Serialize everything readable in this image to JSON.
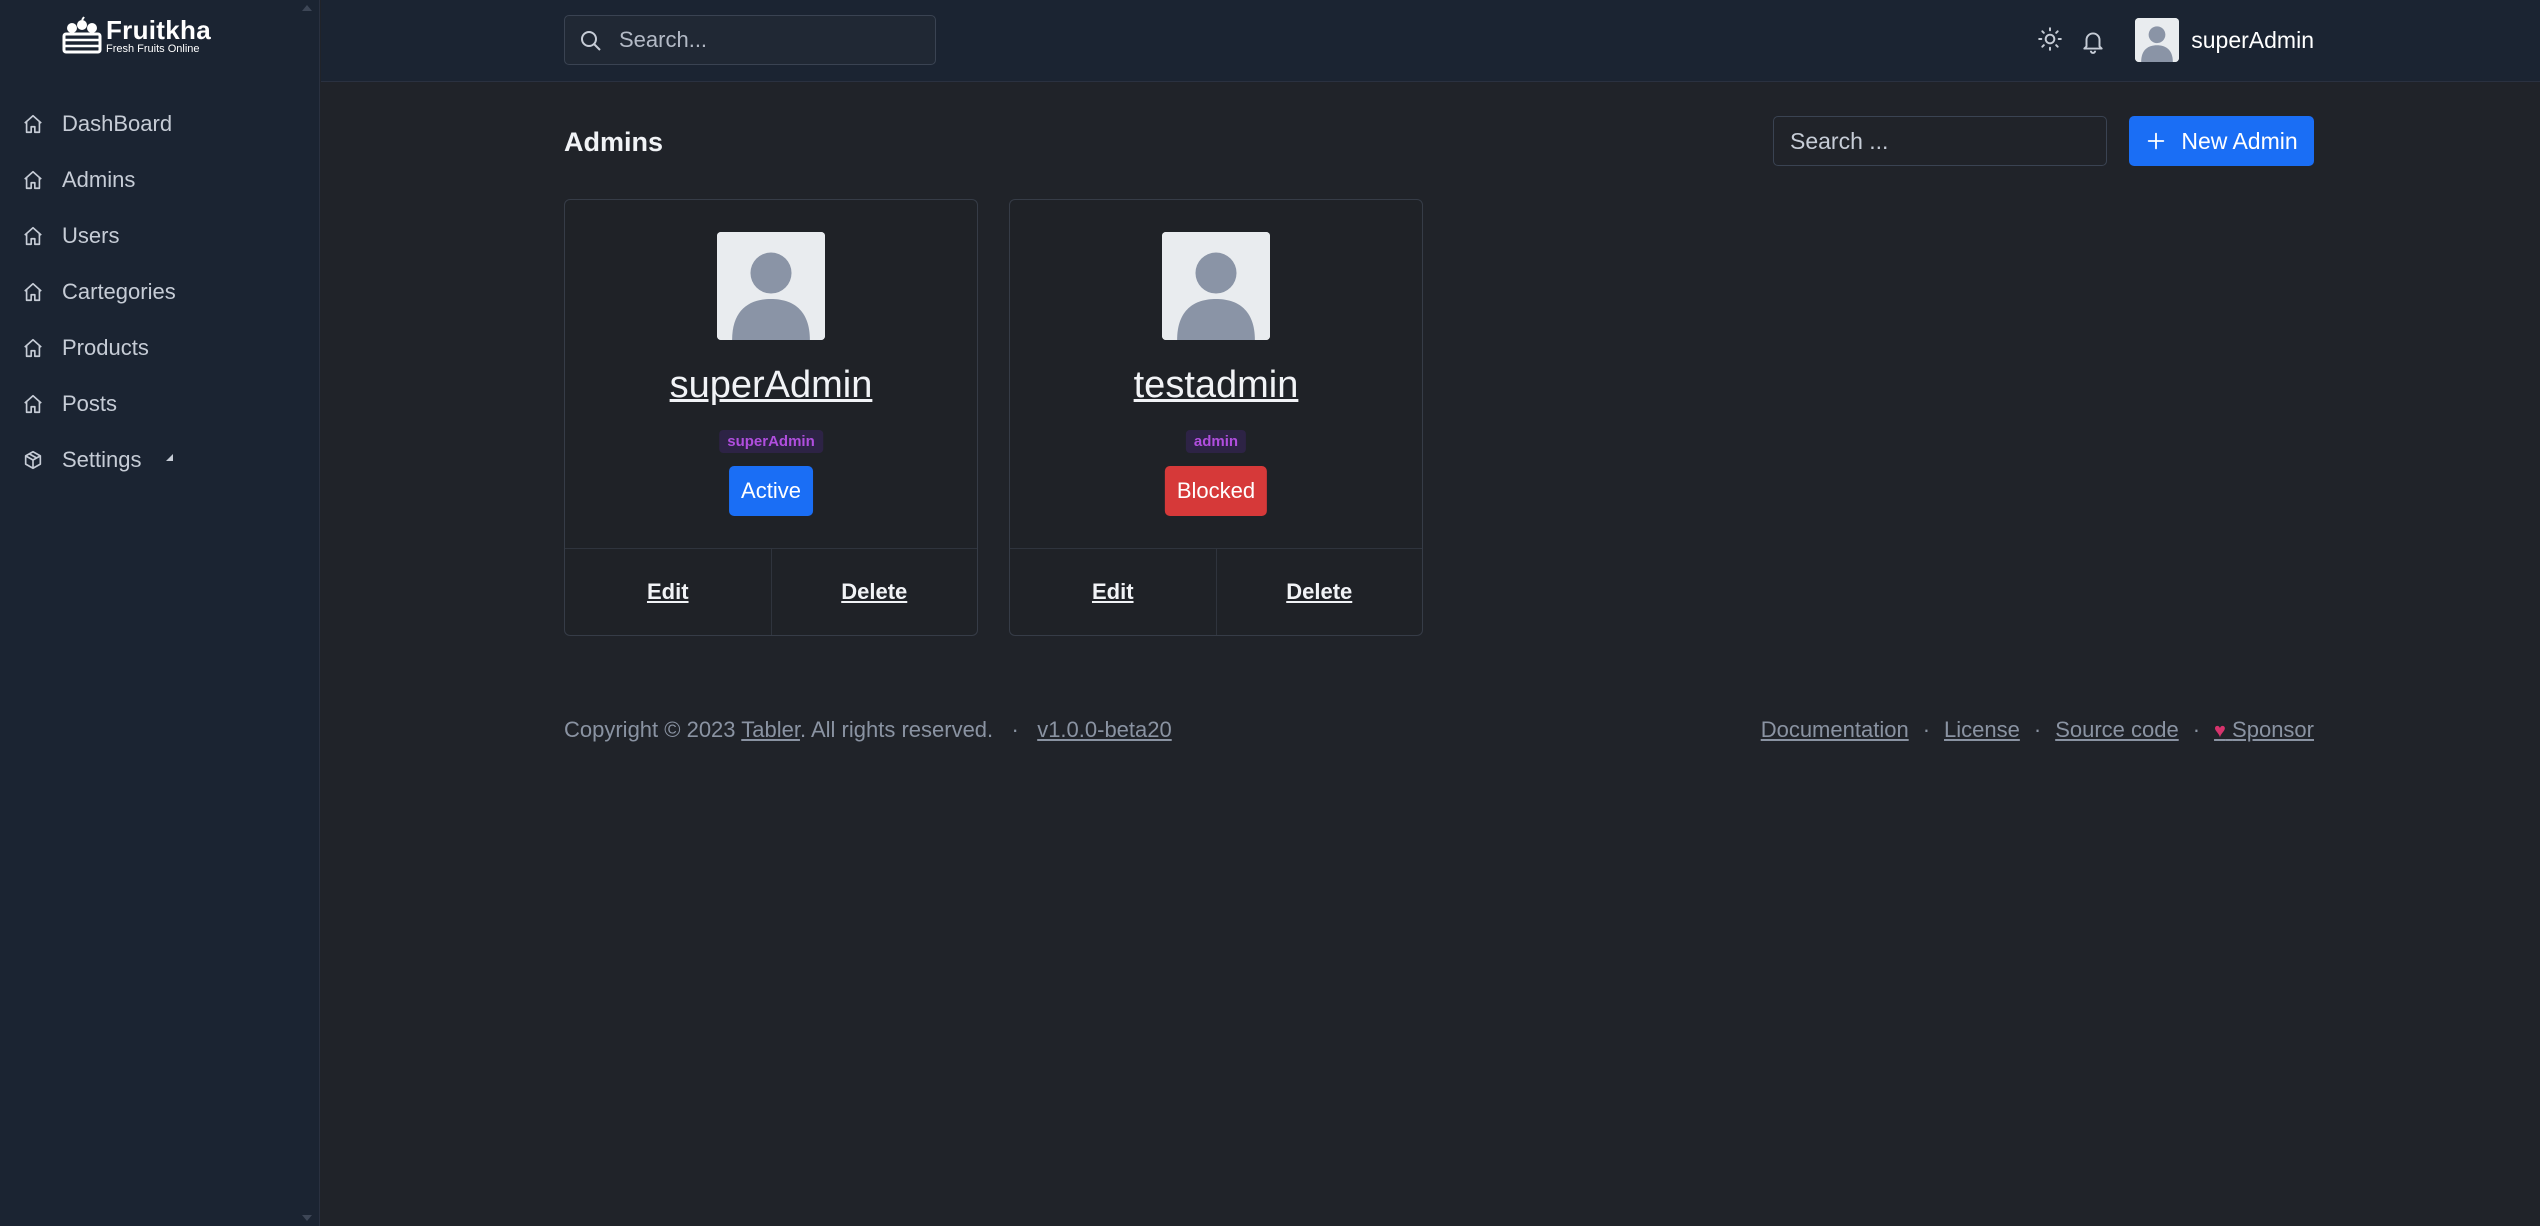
{
  "brand": {
    "name": "Fruitkha",
    "tagline": "Fresh Fruits Online"
  },
  "sidebar": {
    "items": [
      {
        "label": "DashBoard",
        "icon": "home-icon"
      },
      {
        "label": "Admins",
        "icon": "home-icon"
      },
      {
        "label": "Users",
        "icon": "home-icon"
      },
      {
        "label": "Cartegories",
        "icon": "home-icon"
      },
      {
        "label": "Products",
        "icon": "home-icon"
      },
      {
        "label": "Posts",
        "icon": "home-icon"
      },
      {
        "label": "Settings",
        "icon": "package-icon"
      }
    ]
  },
  "header": {
    "search_placeholder": "Search...",
    "user_name": "superAdmin"
  },
  "page": {
    "title": "Admins",
    "search_placeholder": "Search ...",
    "new_button_label": "New Admin"
  },
  "admins": [
    {
      "name": "superAdmin",
      "role": "superAdmin",
      "status": "Active",
      "edit_label": "Edit",
      "delete_label": "Delete"
    },
    {
      "name": "testadmin",
      "role": "admin",
      "status": "Blocked",
      "edit_label": "Edit",
      "delete_label": "Delete"
    }
  ],
  "footer": {
    "copyright_prefix": "Copyright © 2023 ",
    "tabler_link": "Tabler",
    "copyright_suffix": ". All rights reserved.",
    "version": "v1.0.0-beta20",
    "links": [
      "Documentation",
      "License",
      "Source code",
      "Sponsor"
    ]
  },
  "colors": {
    "primary": "#1a6ef5",
    "danger": "#d63939",
    "sidebar_bg": "#1b2432",
    "page_bg": "#202329",
    "role_badge_text": "#b04ede"
  }
}
